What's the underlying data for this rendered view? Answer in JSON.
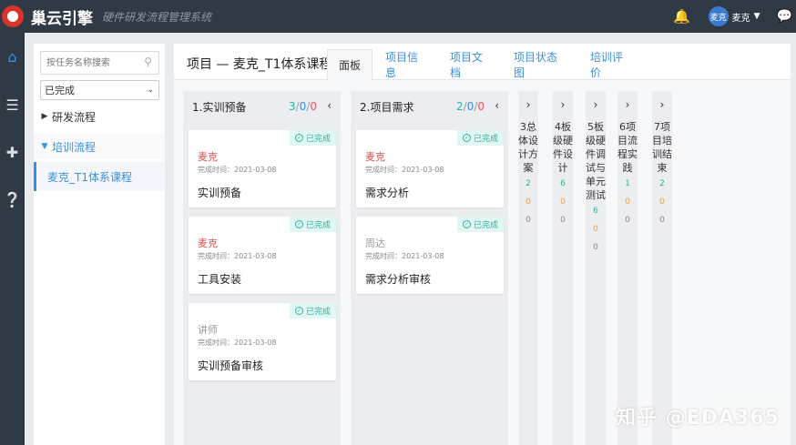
{
  "app": {
    "brand": "巢云引擎",
    "subtitle": "硬件研发流程管理系统"
  },
  "user": {
    "avatar_text": "麦克",
    "name": "麦克"
  },
  "icons": {
    "logo": "logo-icon",
    "bell": "bell-icon",
    "chat": "chat-icon",
    "rail": [
      "home-icon",
      "list-icon",
      "plus-icon",
      "help-icon"
    ]
  },
  "tree": {
    "search_placeholder": "按任务名称搜索",
    "filter_value": "已完成",
    "nodes": [
      {
        "label": "研发流程",
        "expanded": false
      },
      {
        "label": "培训流程",
        "expanded": true
      }
    ],
    "selected_leaf": "麦克_T1体系课程"
  },
  "project": {
    "title": "项目 — 麦克_T1体系课程",
    "tabs": [
      "面板",
      "项目信息",
      "项目文档",
      "项目状态图",
      "培训评价"
    ],
    "active_tab": "面板"
  },
  "columns": [
    {
      "title": "1.实训预备",
      "counts": {
        "done": "3",
        "progress": "0",
        "late": "0"
      },
      "collapse": "‹",
      "cards": [
        {
          "status": "已完成",
          "owner": "麦克",
          "owner_color": "red",
          "time": "完成时间：2021-03-08",
          "title": "实训预备"
        },
        {
          "status": "已完成",
          "owner": "麦克",
          "owner_color": "red",
          "time": "完成时间：2021-03-08",
          "title": "工具安装"
        },
        {
          "status": "已完成",
          "owner": "讲师",
          "owner_color": "gray",
          "time": "完成时间：2021-03-08",
          "title": "实训预备审核"
        }
      ]
    },
    {
      "title": "2.项目需求",
      "counts": {
        "done": "2",
        "progress": "0",
        "late": "0"
      },
      "collapse": "‹",
      "cards": [
        {
          "status": "已完成",
          "owner": "麦克",
          "owner_color": "red",
          "time": "完成时间：2021-03-08",
          "title": "需求分析"
        },
        {
          "status": "已完成",
          "owner": "周达",
          "owner_color": "gray",
          "time": "完成时间：2021-03-08",
          "title": "需求分析审核"
        }
      ]
    }
  ],
  "collapsed_columns": [
    {
      "title": "3总体设计方案",
      "done": "2",
      "progress": "0",
      "late": "0"
    },
    {
      "title": "4板级硬件设计",
      "done": "6",
      "progress": "0",
      "late": "0"
    },
    {
      "title": "5板级硬件调试与单元测试",
      "done": "6",
      "progress": "0",
      "late": "0"
    },
    {
      "title": "6项目流程实践",
      "done": "1",
      "progress": "0",
      "late": "0"
    },
    {
      "title": "7项目培训结束",
      "done": "2",
      "progress": "0",
      "late": "0"
    }
  ],
  "watermark": "知乎 @EDA365",
  "colors": {
    "topbar": "#2f3a45",
    "accent": "#3b8fe0",
    "done": "#29b3a0",
    "late": "#e8555a",
    "owner_red": "#d9534f"
  }
}
